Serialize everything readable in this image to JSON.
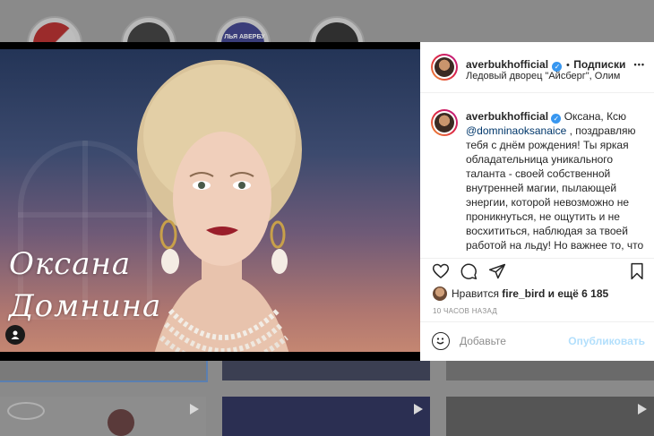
{
  "post": {
    "username": "averbukhofficial",
    "verified_badge": "✓",
    "separator": "•",
    "follow_label": "Подписки",
    "location": "Ледовый дворец \"Айсберг\", Олимпийск…",
    "more_label": "•••",
    "caption_overlay_line1": "Оксана",
    "caption_overlay_line2": "Домнина",
    "comment_text_before": " Оксана, Ксю",
    "comment_mention": "@domninaoksanaice",
    "comment_text_after": " , поздравляю тебя с днём рождения! Ты яркая обладательница уникального таланта - своей собственной внутренней магии, пылающей энергии, которой невозможно не проникнуться, не ощутить и не восхититься, наблюдая за твоей работой на льду! Но важнее то, что не менее сильны твои человеческие качества. Я не",
    "likes_prefix": "Нравится ",
    "likes_user": "fire_bird",
    "likes_suffix": " и ещё 6 185",
    "timestamp": "10 ЧАСОВ НАЗАД",
    "comment_placeholder": "Добавьте",
    "publish_label": "Опубликовать"
  },
  "background": {
    "story_highlight_text": "ЛЬЯ АВЕРБУ"
  },
  "colors": {
    "accent": "#3897f0",
    "link": "#00376b",
    "publish_disabled": "#b2dffc",
    "muted": "#8e8e8e"
  }
}
